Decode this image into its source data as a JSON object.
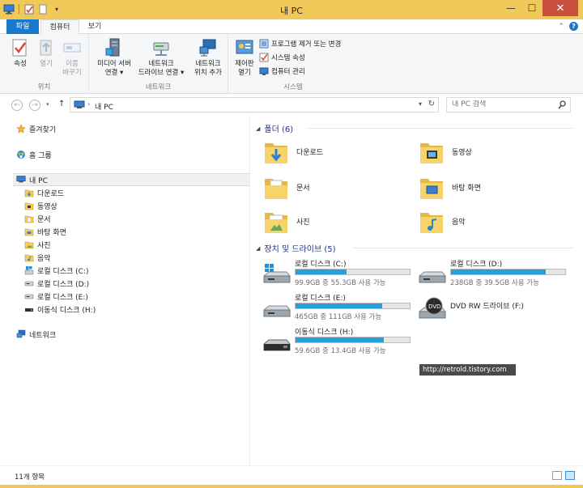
{
  "window": {
    "title": "내 PC",
    "controls": {
      "minimize": "—",
      "maximize": "☐",
      "close": "✕"
    }
  },
  "ribbon_tabs": [
    {
      "label": "파일"
    },
    {
      "label": "컴퓨터"
    },
    {
      "label": "보기"
    }
  ],
  "ribbon_groups": {
    "location": {
      "label": "위치",
      "buttons": [
        {
          "label": "속성"
        },
        {
          "label": "열기"
        },
        {
          "label": "이름\n바꾸기"
        }
      ]
    },
    "network": {
      "label": "네트워크",
      "buttons": [
        {
          "label": "미디어 서버\n연결 ▾"
        },
        {
          "label": "네트워크\n드라이브 연결 ▾"
        },
        {
          "label": "네트워크\n위치 추가"
        }
      ]
    },
    "system": {
      "label": "시스템",
      "control_panel": "제어판\n열기",
      "items": [
        {
          "label": "프로그램 제거 또는 변경"
        },
        {
          "label": "시스템 속성"
        },
        {
          "label": "컴퓨터 관리"
        }
      ]
    }
  },
  "address": {
    "path": "내 PC",
    "search_placeholder": "내 PC 검색"
  },
  "nav": {
    "favorites": "즐겨찾기",
    "homegroup": "홈 그룹",
    "this_pc": "내 PC",
    "children": [
      {
        "label": "다운로드",
        "icon": "download-folder-icon"
      },
      {
        "label": "동영상",
        "icon": "videos-folder-icon"
      },
      {
        "label": "문서",
        "icon": "documents-folder-icon"
      },
      {
        "label": "바탕 화면",
        "icon": "desktop-folder-icon"
      },
      {
        "label": "사진",
        "icon": "pictures-folder-icon"
      },
      {
        "label": "음악",
        "icon": "music-folder-icon"
      },
      {
        "label": "로컬 디스크 (C:)",
        "icon": "windows-drive-icon"
      },
      {
        "label": "로컬 디스크 (D:)",
        "icon": "drive-icon"
      },
      {
        "label": "로컬 디스크 (E:)",
        "icon": "drive-icon"
      },
      {
        "label": "이동식 디스크 (H:)",
        "icon": "removable-drive-icon"
      }
    ],
    "network": "네트워크"
  },
  "folders_section": {
    "header": "폴더 (6)",
    "items": [
      {
        "label": "다운로드",
        "icon": "download-folder-icon"
      },
      {
        "label": "동영상",
        "icon": "videos-folder-icon"
      },
      {
        "label": "문서",
        "icon": "documents-folder-icon"
      },
      {
        "label": "바탕 화면",
        "icon": "desktop-folder-icon"
      },
      {
        "label": "사진",
        "icon": "pictures-folder-icon"
      },
      {
        "label": "음악",
        "icon": "music-folder-icon"
      }
    ]
  },
  "drives_section": {
    "header": "장치 및 드라이브 (5)",
    "items": [
      {
        "name": "로컬 디스크 (C:)",
        "free": "99.9GB 중 55.3GB 사용 가능",
        "used_fraction": 0.45,
        "icon": "windows-drive-icon"
      },
      {
        "name": "로컬 디스크 (D:)",
        "free": "238GB 중 39.5GB 사용 가능",
        "used_fraction": 0.83,
        "icon": "drive-icon"
      },
      {
        "name": "로컬 디스크 (E:)",
        "free": "465GB 중 111GB 사용 가능",
        "used_fraction": 0.76,
        "icon": "drive-icon"
      },
      {
        "name": "DVD RW 드라이브 (F:)",
        "free": "",
        "used_fraction": null,
        "icon": "dvd-drive-icon"
      },
      {
        "name": "이동식 디스크 (H:)",
        "free": "59.6GB 중 13.4GB 사용 가능",
        "used_fraction": 0.77,
        "icon": "removable-drive-icon"
      }
    ]
  },
  "watermark": "http://retrold.tistory.com",
  "status": {
    "item_count": "11개 항목"
  },
  "colors": {
    "frame": "#f1c959",
    "file_tab": "#1979ca",
    "progress": "#26a0da",
    "section_header": "#1e3287"
  }
}
